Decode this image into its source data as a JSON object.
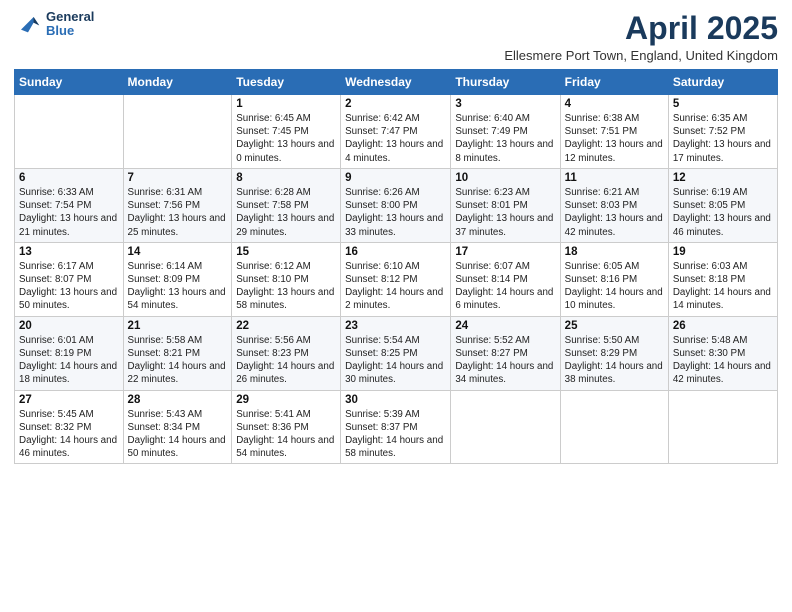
{
  "logo": {
    "line1": "General",
    "line2": "Blue"
  },
  "title": "April 2025",
  "location": "Ellesmere Port Town, England, United Kingdom",
  "weekdays": [
    "Sunday",
    "Monday",
    "Tuesday",
    "Wednesday",
    "Thursday",
    "Friday",
    "Saturday"
  ],
  "weeks": [
    [
      {
        "day": "",
        "info": ""
      },
      {
        "day": "",
        "info": ""
      },
      {
        "day": "1",
        "info": "Sunrise: 6:45 AM\nSunset: 7:45 PM\nDaylight: 13 hours and 0 minutes."
      },
      {
        "day": "2",
        "info": "Sunrise: 6:42 AM\nSunset: 7:47 PM\nDaylight: 13 hours and 4 minutes."
      },
      {
        "day": "3",
        "info": "Sunrise: 6:40 AM\nSunset: 7:49 PM\nDaylight: 13 hours and 8 minutes."
      },
      {
        "day": "4",
        "info": "Sunrise: 6:38 AM\nSunset: 7:51 PM\nDaylight: 13 hours and 12 minutes."
      },
      {
        "day": "5",
        "info": "Sunrise: 6:35 AM\nSunset: 7:52 PM\nDaylight: 13 hours and 17 minutes."
      }
    ],
    [
      {
        "day": "6",
        "info": "Sunrise: 6:33 AM\nSunset: 7:54 PM\nDaylight: 13 hours and 21 minutes."
      },
      {
        "day": "7",
        "info": "Sunrise: 6:31 AM\nSunset: 7:56 PM\nDaylight: 13 hours and 25 minutes."
      },
      {
        "day": "8",
        "info": "Sunrise: 6:28 AM\nSunset: 7:58 PM\nDaylight: 13 hours and 29 minutes."
      },
      {
        "day": "9",
        "info": "Sunrise: 6:26 AM\nSunset: 8:00 PM\nDaylight: 13 hours and 33 minutes."
      },
      {
        "day": "10",
        "info": "Sunrise: 6:23 AM\nSunset: 8:01 PM\nDaylight: 13 hours and 37 minutes."
      },
      {
        "day": "11",
        "info": "Sunrise: 6:21 AM\nSunset: 8:03 PM\nDaylight: 13 hours and 42 minutes."
      },
      {
        "day": "12",
        "info": "Sunrise: 6:19 AM\nSunset: 8:05 PM\nDaylight: 13 hours and 46 minutes."
      }
    ],
    [
      {
        "day": "13",
        "info": "Sunrise: 6:17 AM\nSunset: 8:07 PM\nDaylight: 13 hours and 50 minutes."
      },
      {
        "day": "14",
        "info": "Sunrise: 6:14 AM\nSunset: 8:09 PM\nDaylight: 13 hours and 54 minutes."
      },
      {
        "day": "15",
        "info": "Sunrise: 6:12 AM\nSunset: 8:10 PM\nDaylight: 13 hours and 58 minutes."
      },
      {
        "day": "16",
        "info": "Sunrise: 6:10 AM\nSunset: 8:12 PM\nDaylight: 14 hours and 2 minutes."
      },
      {
        "day": "17",
        "info": "Sunrise: 6:07 AM\nSunset: 8:14 PM\nDaylight: 14 hours and 6 minutes."
      },
      {
        "day": "18",
        "info": "Sunrise: 6:05 AM\nSunset: 8:16 PM\nDaylight: 14 hours and 10 minutes."
      },
      {
        "day": "19",
        "info": "Sunrise: 6:03 AM\nSunset: 8:18 PM\nDaylight: 14 hours and 14 minutes."
      }
    ],
    [
      {
        "day": "20",
        "info": "Sunrise: 6:01 AM\nSunset: 8:19 PM\nDaylight: 14 hours and 18 minutes."
      },
      {
        "day": "21",
        "info": "Sunrise: 5:58 AM\nSunset: 8:21 PM\nDaylight: 14 hours and 22 minutes."
      },
      {
        "day": "22",
        "info": "Sunrise: 5:56 AM\nSunset: 8:23 PM\nDaylight: 14 hours and 26 minutes."
      },
      {
        "day": "23",
        "info": "Sunrise: 5:54 AM\nSunset: 8:25 PM\nDaylight: 14 hours and 30 minutes."
      },
      {
        "day": "24",
        "info": "Sunrise: 5:52 AM\nSunset: 8:27 PM\nDaylight: 14 hours and 34 minutes."
      },
      {
        "day": "25",
        "info": "Sunrise: 5:50 AM\nSunset: 8:29 PM\nDaylight: 14 hours and 38 minutes."
      },
      {
        "day": "26",
        "info": "Sunrise: 5:48 AM\nSunset: 8:30 PM\nDaylight: 14 hours and 42 minutes."
      }
    ],
    [
      {
        "day": "27",
        "info": "Sunrise: 5:45 AM\nSunset: 8:32 PM\nDaylight: 14 hours and 46 minutes."
      },
      {
        "day": "28",
        "info": "Sunrise: 5:43 AM\nSunset: 8:34 PM\nDaylight: 14 hours and 50 minutes."
      },
      {
        "day": "29",
        "info": "Sunrise: 5:41 AM\nSunset: 8:36 PM\nDaylight: 14 hours and 54 minutes."
      },
      {
        "day": "30",
        "info": "Sunrise: 5:39 AM\nSunset: 8:37 PM\nDaylight: 14 hours and 58 minutes."
      },
      {
        "day": "",
        "info": ""
      },
      {
        "day": "",
        "info": ""
      },
      {
        "day": "",
        "info": ""
      }
    ]
  ]
}
